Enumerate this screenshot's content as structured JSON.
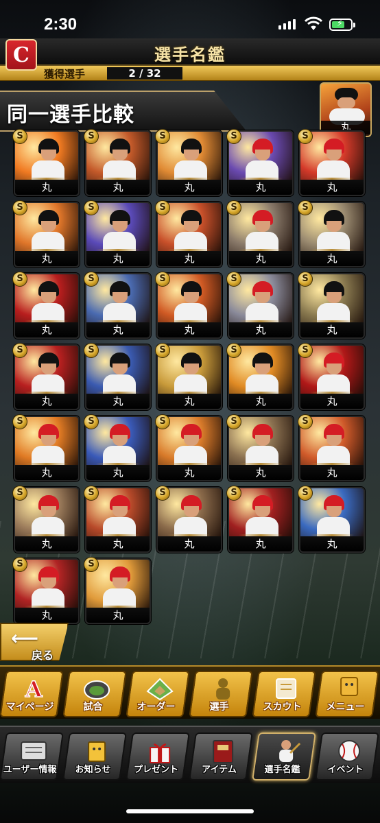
{
  "status": {
    "time": "2:30"
  },
  "header": {
    "title": "選手名鑑",
    "team_logo_letter": "C"
  },
  "acquired": {
    "label": "獲得選手",
    "count": "2 / 32"
  },
  "comparison": {
    "title": "同一選手比較",
    "selected_player": "丸"
  },
  "cards": [
    {
      "name": "丸",
      "team": "giants",
      "bg": "#f07a22"
    },
    {
      "name": "丸",
      "team": "giants",
      "bg": "#c45a2a"
    },
    {
      "name": "丸",
      "team": "giants",
      "bg": "#e08a34"
    },
    {
      "name": "丸",
      "team": "carp",
      "bg": "#6a4ab0"
    },
    {
      "name": "丸",
      "team": "carp",
      "bg": "#d43a2a"
    },
    {
      "name": "丸",
      "team": "giants",
      "bg": "#e0762a"
    },
    {
      "name": "丸",
      "team": "giants",
      "bg": "#5a4ab8"
    },
    {
      "name": "丸",
      "team": "giants",
      "bg": "#c8502a"
    },
    {
      "name": "丸",
      "team": "carp",
      "bg": "#8a7a6a"
    },
    {
      "name": "丸",
      "team": "giants",
      "bg": "#9a8a70"
    },
    {
      "name": "丸",
      "team": "giants",
      "bg": "#b81e1e"
    },
    {
      "name": "丸",
      "team": "giants",
      "bg": "#4a6ab0"
    },
    {
      "name": "丸",
      "team": "giants",
      "bg": "#d05a24"
    },
    {
      "name": "丸",
      "team": "carp",
      "bg": "#8a8a9a"
    },
    {
      "name": "丸",
      "team": "giants",
      "bg": "#8a7a50"
    },
    {
      "name": "丸",
      "team": "giants",
      "bg": "#b82020"
    },
    {
      "name": "丸",
      "team": "giants",
      "bg": "#3a5ab0"
    },
    {
      "name": "丸",
      "team": "giants",
      "bg": "#c89a3a"
    },
    {
      "name": "丸",
      "team": "giants",
      "bg": "#e08a24"
    },
    {
      "name": "丸",
      "team": "carp",
      "bg": "#b01818"
    },
    {
      "name": "丸",
      "team": "carp",
      "bg": "#e07a24"
    },
    {
      "name": "丸",
      "team": "carp",
      "bg": "#3a5ab8"
    },
    {
      "name": "丸",
      "team": "carp",
      "bg": "#d87a2a"
    },
    {
      "name": "丸",
      "team": "carp",
      "bg": "#8a7050"
    },
    {
      "name": "丸",
      "team": "carp",
      "bg": "#d05a2a"
    },
    {
      "name": "丸",
      "team": "carp",
      "bg": "#9a7a5a"
    },
    {
      "name": "丸",
      "team": "carp",
      "bg": "#b84a2a"
    },
    {
      "name": "丸",
      "team": "carp",
      "bg": "#8a6a4a"
    },
    {
      "name": "丸",
      "team": "carp",
      "bg": "#a02020"
    },
    {
      "name": "丸",
      "team": "carp",
      "bg": "#3a6ac0"
    },
    {
      "name": "丸",
      "team": "carp",
      "bg": "#b02424"
    },
    {
      "name": "丸",
      "team": "carp",
      "bg": "#e09a3a"
    }
  ],
  "back": {
    "label": "戻る"
  },
  "nav_main": [
    {
      "label": "マイページ",
      "icon": "a-icon"
    },
    {
      "label": "試合",
      "icon": "stadium-icon"
    },
    {
      "label": "オーダー",
      "icon": "field-icon"
    },
    {
      "label": "選手",
      "icon": "player-icon"
    },
    {
      "label": "スカウト",
      "icon": "scout-icon"
    },
    {
      "label": "メニュー",
      "icon": "menu-icon"
    }
  ],
  "nav_sub": [
    {
      "label": "ユーザー情報",
      "icon": "user-info-icon"
    },
    {
      "label": "お知らせ",
      "icon": "notice-icon"
    },
    {
      "label": "プレゼント",
      "icon": "present-icon"
    },
    {
      "label": "アイテム",
      "icon": "item-icon"
    },
    {
      "label": "選手名鑑",
      "icon": "player-book-icon"
    },
    {
      "label": "イベント",
      "icon": "event-icon"
    }
  ]
}
